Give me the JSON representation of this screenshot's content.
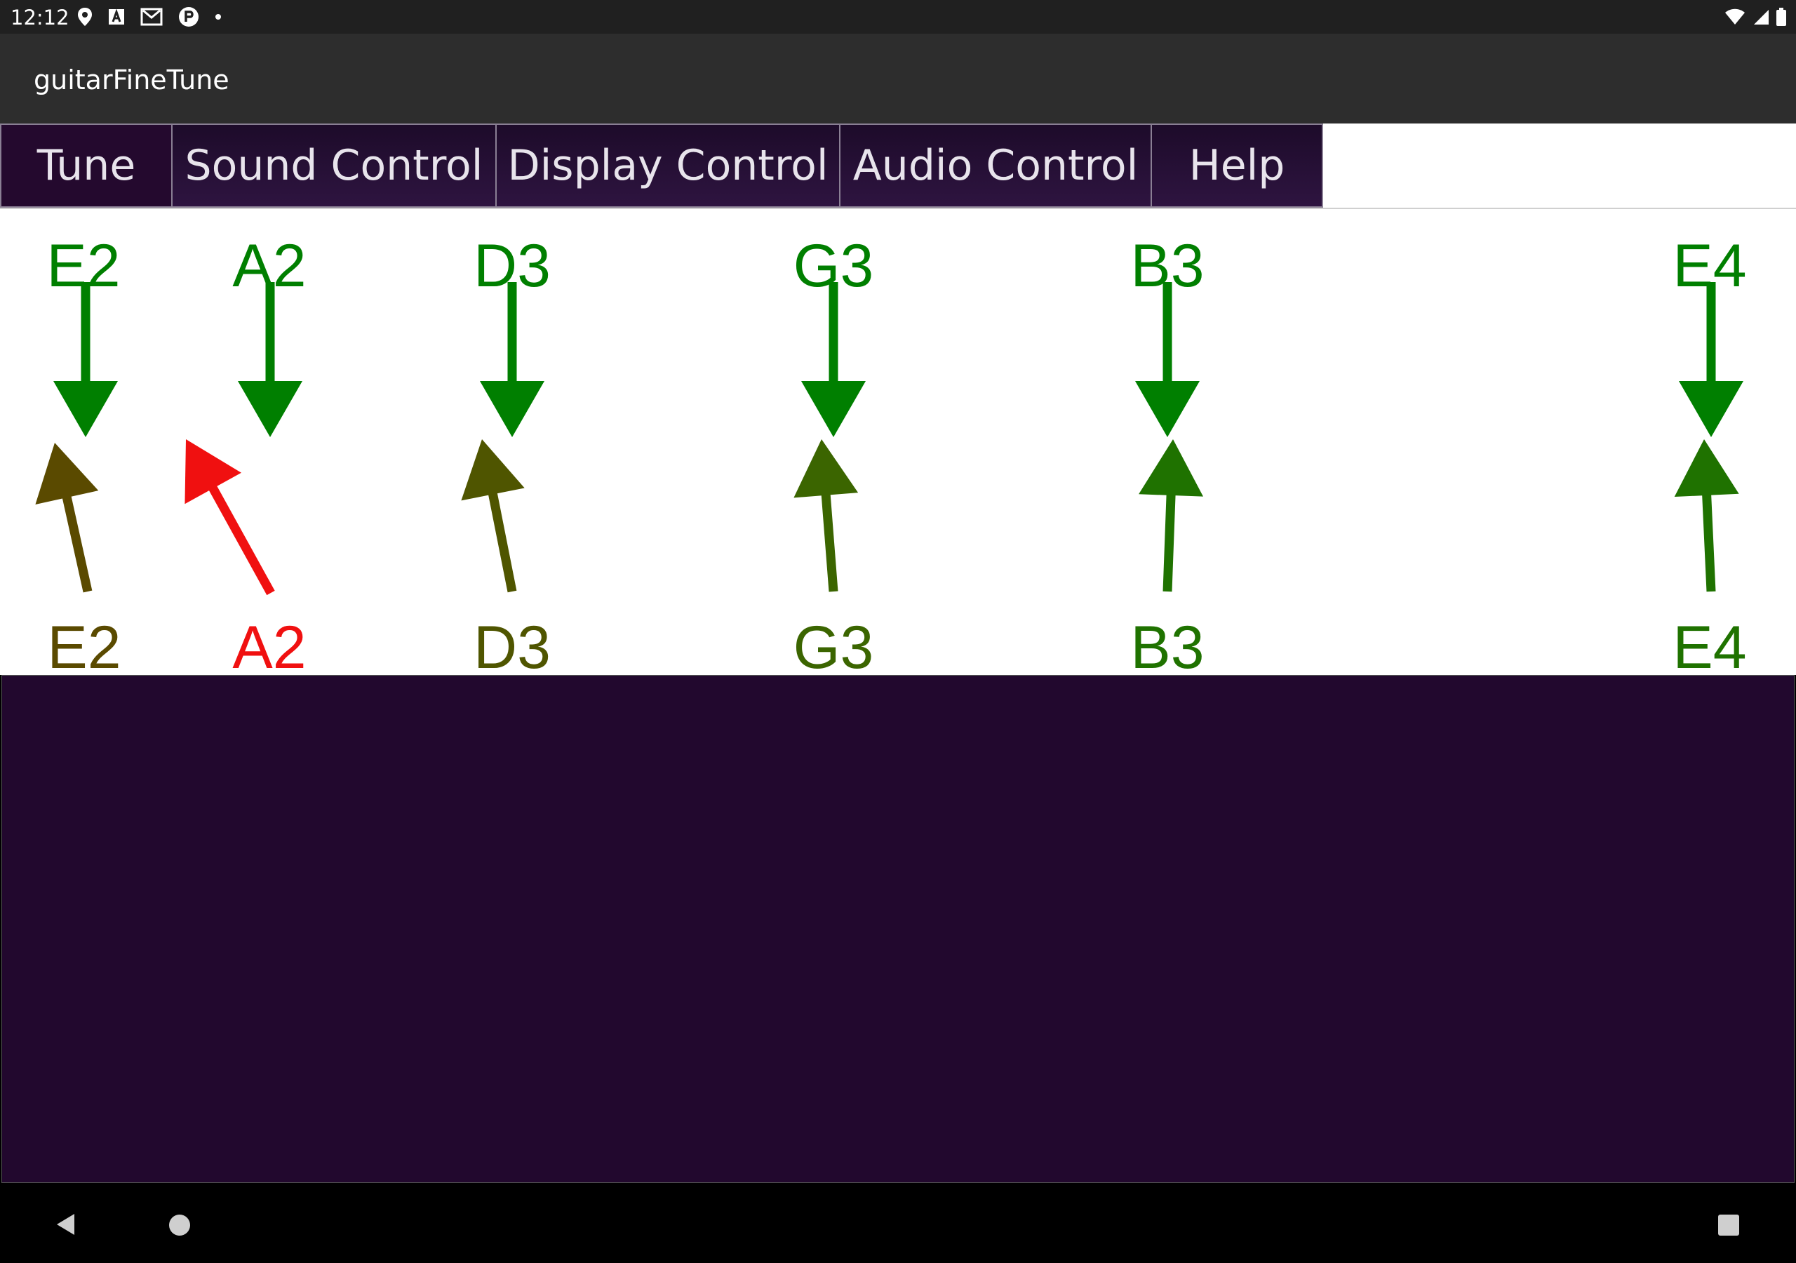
{
  "status_bar": {
    "time": "12:12",
    "left_icons": [
      "location-pin-icon",
      "font-a-icon",
      "gmail-icon",
      "app-p-icon",
      "dot-icon"
    ],
    "right_icons": [
      "wifi-icon",
      "cell-signal-icon",
      "battery-icon"
    ]
  },
  "app": {
    "title": "guitarFineTune"
  },
  "tabs": [
    {
      "label": "Tune",
      "active": true
    },
    {
      "label": "Sound Control",
      "active": false
    },
    {
      "label": "Display Control",
      "active": false
    },
    {
      "label": "Audio Control",
      "active": false
    },
    {
      "label": "Help",
      "active": false
    }
  ],
  "tuner": {
    "reference_notes": [
      {
        "note": "E2",
        "color": "#007f00"
      },
      {
        "note": "A2",
        "color": "#007f00"
      },
      {
        "note": "D3",
        "color": "#007f00"
      },
      {
        "note": "G3",
        "color": "#007f00"
      },
      {
        "note": "B3",
        "color": "#007f00"
      },
      {
        "note": "E4",
        "color": "#007f00"
      }
    ],
    "detected_notes": [
      {
        "note": "E2",
        "color": "#5a4a00"
      },
      {
        "note": "A2",
        "color": "#f01010"
      },
      {
        "note": "D3",
        "color": "#4f5500"
      },
      {
        "note": "G3",
        "color": "#3b6500"
      },
      {
        "note": "B3",
        "color": "#1f7200"
      },
      {
        "note": "E4",
        "color": "#1f7200"
      }
    ]
  },
  "nav_bar": {
    "buttons": [
      "back-icon",
      "home-icon",
      "recents-icon"
    ]
  }
}
